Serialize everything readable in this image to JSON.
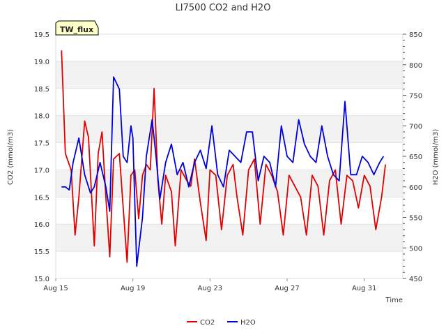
{
  "chart_data": {
    "type": "line",
    "title": "LI7500 CO2 and H2O",
    "site_badge": "TW_flux",
    "xlabel": "Time",
    "ylabel_left": "CO2 (mmol/m3)",
    "ylabel_right": "H2O (mmol/m3)",
    "x_ticks": [
      "Aug 15",
      "Aug 19",
      "Aug 23",
      "Aug 27",
      "Aug 31"
    ],
    "x_tick_days": [
      15,
      19,
      23,
      27,
      31
    ],
    "xlim": [
      15,
      33
    ],
    "ylim_left": [
      15.0,
      19.5
    ],
    "ylim_right": [
      450,
      850
    ],
    "y_ticks_left": [
      "15.0",
      "15.5",
      "16.0",
      "16.5",
      "17.0",
      "17.5",
      "18.0",
      "18.5",
      "19.0",
      "19.5"
    ],
    "y_ticks_right": [
      "450",
      "500",
      "550",
      "600",
      "650",
      "700",
      "750",
      "800",
      "850"
    ],
    "grid": "horizontal alternating bands",
    "legend_placement": "bottom",
    "series": [
      {
        "name": "CO2",
        "axis": "left",
        "color": "#e00000",
        "x": [
          15.3,
          15.5,
          15.8,
          16.0,
          16.2,
          16.5,
          16.7,
          17.0,
          17.2,
          17.4,
          17.6,
          17.8,
          18.0,
          18.3,
          18.5,
          18.7,
          18.9,
          19.1,
          19.3,
          19.5,
          19.7,
          19.9,
          20.1,
          20.3,
          20.5,
          20.7,
          21.0,
          21.2,
          21.5,
          21.8,
          22.0,
          22.2,
          22.5,
          22.8,
          23.0,
          23.3,
          23.6,
          23.9,
          24.2,
          24.4,
          24.7,
          25.0,
          25.3,
          25.6,
          25.9,
          26.2,
          26.5,
          26.8,
          27.1,
          27.4,
          27.7,
          28.0,
          28.3,
          28.6,
          28.9,
          29.2,
          29.5,
          29.8,
          30.1,
          30.4,
          30.7,
          31.0,
          31.3,
          31.6,
          31.9,
          32.1
        ],
        "values": [
          19.2,
          17.3,
          17.0,
          15.8,
          16.5,
          17.9,
          17.6,
          15.6,
          17.3,
          17.7,
          16.5,
          15.4,
          17.2,
          17.3,
          16.3,
          15.3,
          16.9,
          17.0,
          16.1,
          16.9,
          17.1,
          17.0,
          18.5,
          16.8,
          16.0,
          16.9,
          16.6,
          15.6,
          17.0,
          16.8,
          16.7,
          17.2,
          16.4,
          15.7,
          17.0,
          16.9,
          15.9,
          16.9,
          17.1,
          16.5,
          15.8,
          17.0,
          17.2,
          16.0,
          17.1,
          16.9,
          16.6,
          15.8,
          16.9,
          16.7,
          16.5,
          15.8,
          16.9,
          16.7,
          15.8,
          16.8,
          17.0,
          16.0,
          16.9,
          16.8,
          16.3,
          16.9,
          16.7,
          15.9,
          16.5,
          17.1
        ]
      },
      {
        "name": "H2O",
        "axis": "right",
        "color": "#0000dd",
        "x": [
          15.3,
          15.5,
          15.7,
          15.9,
          16.2,
          16.5,
          16.8,
          17.0,
          17.3,
          17.6,
          17.8,
          18.0,
          18.3,
          18.5,
          18.7,
          18.9,
          19.0,
          19.2,
          19.5,
          19.7,
          20.0,
          20.2,
          20.4,
          20.7,
          21.0,
          21.3,
          21.6,
          21.9,
          22.2,
          22.5,
          22.8,
          23.1,
          23.4,
          23.7,
          24.0,
          24.3,
          24.6,
          24.9,
          25.2,
          25.5,
          25.8,
          26.1,
          26.4,
          26.7,
          27.0,
          27.3,
          27.6,
          27.9,
          28.2,
          28.5,
          28.8,
          29.1,
          29.4,
          29.7,
          30.0,
          30.3,
          30.6,
          30.9,
          31.2,
          31.5,
          31.8,
          32.0
        ],
        "values": [
          600,
          600,
          595,
          640,
          680,
          620,
          590,
          600,
          640,
          600,
          560,
          780,
          760,
          650,
          640,
          700,
          680,
          470,
          550,
          650,
          710,
          650,
          580,
          640,
          670,
          620,
          640,
          600,
          640,
          660,
          630,
          700,
          620,
          600,
          660,
          650,
          640,
          690,
          690,
          610,
          650,
          640,
          600,
          700,
          650,
          640,
          710,
          670,
          650,
          640,
          700,
          650,
          620,
          610,
          740,
          620,
          620,
          650,
          640,
          620,
          640,
          650
        ]
      }
    ]
  }
}
